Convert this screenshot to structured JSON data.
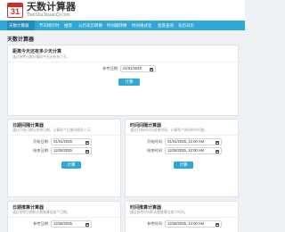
{
  "header": {
    "logo_day": "31",
    "title": "天数计算器",
    "url": "TianShuJisuanQi.com"
  },
  "nav": {
    "items": [
      {
        "label": "天数计算器"
      },
      {
        "label": "节日倒计时"
      },
      {
        "label": "推荐"
      },
      {
        "label": "公历农历转换"
      },
      {
        "label": "时间戳转换"
      },
      {
        "label": "时间格式化"
      },
      {
        "label": "星座查询"
      },
      {
        "label": "农历日历"
      }
    ]
  },
  "main": {
    "section_title": "天数计算器",
    "countdown_card": {
      "title": "距离今天还有多少天计算",
      "desc": "通过参考日期计算距今天还有多少天。",
      "date_label": "参考日期:",
      "date_value": "01/01/2025",
      "button_label": "计算"
    },
    "interval_card": {
      "title": "日期间隔计算器",
      "desc": "通过开始日期与结束日期，计算两个日期间隔多少天。",
      "start_label": "开始日期:",
      "start_value": "01/01/2025",
      "end_label": "结束日期:",
      "end_value": "12/28/2025",
      "button_label": "计算"
    },
    "time_interval_card": {
      "title": "时间间隔计算器",
      "desc": "通过开始时间与结束时间，计算两个时间的时间差。",
      "start_label": "开始时间:",
      "start_value": "01/01/2025, 12:00 AM",
      "end_label": "结束时间:",
      "end_value": "12/28/2025, 12:00 AM",
      "button_label": "计算"
    },
    "date_push_card": {
      "title": "日期推算计算器",
      "desc": "通过参考日期和天数推算出某个日期。",
      "date_label": "参考日期:",
      "date_value": "12/28/2025"
    },
    "time_push_card": {
      "title": "时间推算计算器",
      "desc": "通过参考时间和天数推算出某个时间。",
      "date_label": "参考时间:",
      "date_value": "12/28/2025, 12:00 AM"
    }
  }
}
